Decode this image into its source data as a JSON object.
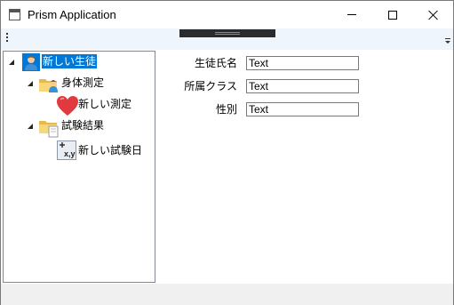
{
  "window": {
    "title": "Prism Application"
  },
  "tree": {
    "nodes": [
      {
        "label": "新しい生徒",
        "icon": "student-icon"
      },
      {
        "label": "身体測定",
        "icon": "folder-person-icon"
      },
      {
        "label": "新しい測定",
        "icon": "heart-icon"
      },
      {
        "label": "試験結果",
        "icon": "folder-document-icon"
      },
      {
        "label": "新しい試験日",
        "icon": "chart-xy-icon"
      }
    ]
  },
  "form": {
    "fields": [
      {
        "label": "生徒氏名",
        "value": "Text"
      },
      {
        "label": "所属クラス",
        "value": "Text"
      },
      {
        "label": "性別",
        "value": "Text"
      }
    ]
  },
  "colors": {
    "selection": "#0078d7",
    "toolbar": "#eef5fc",
    "statusbar": "#f0f0f0"
  }
}
